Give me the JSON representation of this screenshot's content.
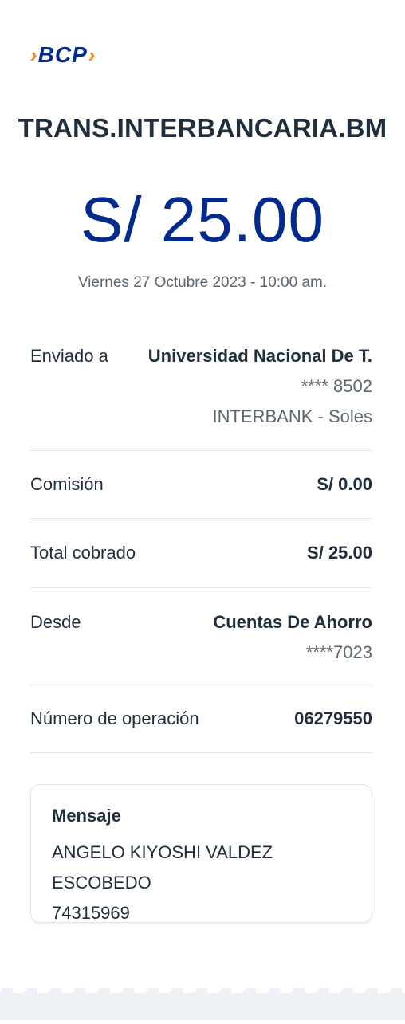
{
  "brand": {
    "name": "BCP",
    "color": "#002a8d",
    "accent": "#f7841e"
  },
  "title": "TRANS.INTERBANCARIA.BM",
  "amount": "S/ 25.00",
  "datetime": "Viernes 27 Octubre 2023 - 10:00 am.",
  "details": {
    "sent_to": {
      "label": "Enviado a",
      "name": "Universidad Nacional De T.",
      "account": "**** 8502",
      "bank": "INTERBANK - Soles"
    },
    "commission": {
      "label": "Comisión",
      "value": "S/ 0.00"
    },
    "total": {
      "label": "Total cobrado",
      "value": "S/ 25.00"
    },
    "from": {
      "label": "Desde",
      "account_name": "Cuentas De Ahorro",
      "account": "****7023"
    },
    "operation": {
      "label": "Número de operación",
      "value": "06279550"
    }
  },
  "message": {
    "title": "Mensaje",
    "line1": "ANGELO KIYOSHI VALDEZ ESCOBEDO",
    "line2": "74315969"
  }
}
